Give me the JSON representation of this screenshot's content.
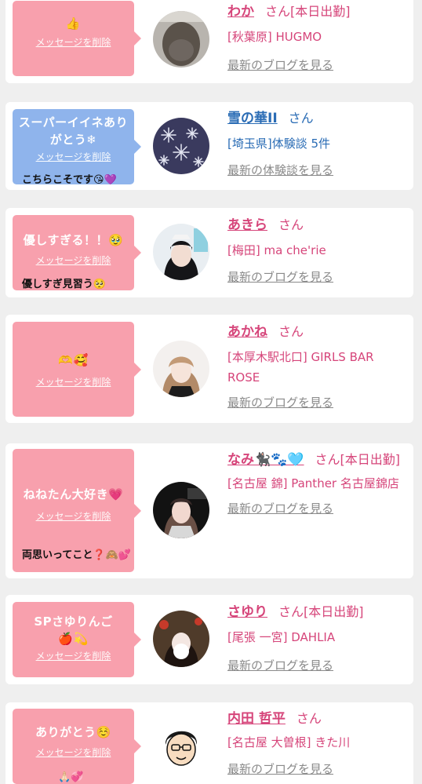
{
  "entries": [
    {
      "message": "👍",
      "delete_label": "メッセージを削除",
      "name": "わか",
      "honorific": "さん[本日出勤]",
      "shop": "[秋葉原] HUGMO",
      "link": "最新のブログを見る",
      "avatar": "avatar-photo"
    },
    {
      "message": "スーパーイイネありがとう❄",
      "delete_label": "メッセージを削除",
      "reply": "こちらこそです😘💜",
      "name": "雪の華II",
      "honorific": "さん",
      "shop": "[埼玉県]体験談 5件",
      "link": "最新の体験談を見る",
      "avatar": "snowflake-avatar"
    },
    {
      "message": "優しすぎる！！🥹",
      "delete_label": "メッセージを削除",
      "reply": "優しすぎ見習う🥺",
      "name": "あきら",
      "honorific": "さん",
      "shop": "[梅田] ma che'rie",
      "link": "最新のブログを見る",
      "avatar": "avatar-photo"
    },
    {
      "message": "🫶🥰",
      "delete_label": "メッセージを削除",
      "name": "あかね",
      "honorific": "さん",
      "shop": "[本厚木駅北口] GIRLS BAR ROSE",
      "link": "最新のブログを見る",
      "avatar": "avatar-photo"
    },
    {
      "message": "ねねたん大好き💗",
      "delete_label": "メッセージを削除",
      "reply": "両思いってこと❓🙈💕",
      "name": "なみ🐈‍⬛🐾🩵",
      "honorific": "さん[本日出勤]",
      "shop": "[名古屋 錦] Panther 名古屋錦店",
      "link": "最新のブログを見る",
      "avatar": "avatar-photo"
    },
    {
      "message": "SPさゆりんご🍎💫",
      "delete_label": "メッセージを削除",
      "name": "さゆり",
      "honorific": "さん[本日出勤]",
      "shop": "[尾張 一宮] DAHLIA",
      "link": "最新のブログを見る",
      "avatar": "avatar-photo"
    },
    {
      "message": "ありがとう☺️",
      "delete_label": "メッセージを削除",
      "reply": "🙏🏻💞",
      "name": "内田 哲平",
      "honorific": "さん",
      "shop": "[名古屋 大曽根] きた川",
      "link": "最新のブログを見る",
      "avatar": "cartoon-avatar"
    }
  ],
  "colors": {
    "pink_bubble": "#f8a0ad",
    "blue_bubble": "#8fb4ec",
    "name_pink": "#d6457a",
    "name_blue": "#2a6cb5",
    "link_gray": "#8a8a8a"
  }
}
